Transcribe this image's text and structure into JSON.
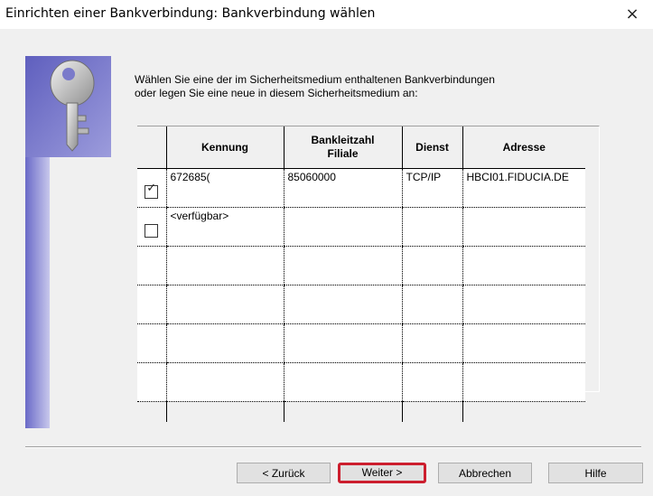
{
  "window": {
    "title": "Einrichten einer Bankverbindung: Bankverbindung wählen",
    "close_glyph": "×"
  },
  "icons": {
    "banner": "key-icon"
  },
  "intro": {
    "line1": "Wählen Sie eine der im Sicherheitsmedium enthaltenen Bankverbindungen",
    "line2": "oder legen Sie eine neue in diesem Sicherheitsmedium an:"
  },
  "table": {
    "headers": {
      "kennung": "Kennung",
      "blz_line1": "Bankleitzahl",
      "blz_line2": "Filiale",
      "dienst": "Dienst",
      "adresse": "Adresse"
    },
    "rows": [
      {
        "checked": true,
        "kennung": "672685(",
        "blz": "85060000",
        "dienst": "TCP/IP",
        "adresse": "HBCI01.FIDUCIA.DE"
      },
      {
        "checked": false,
        "kennung": "<verfügbar>",
        "blz": "",
        "dienst": "",
        "adresse": ""
      }
    ]
  },
  "buttons": {
    "back": "< Zurück",
    "next": "Weiter >",
    "cancel": "Abbrechen",
    "help": "Hilfe"
  },
  "colors": {
    "highlight": "#cc1e2e",
    "banner": "#6a6ac8"
  }
}
